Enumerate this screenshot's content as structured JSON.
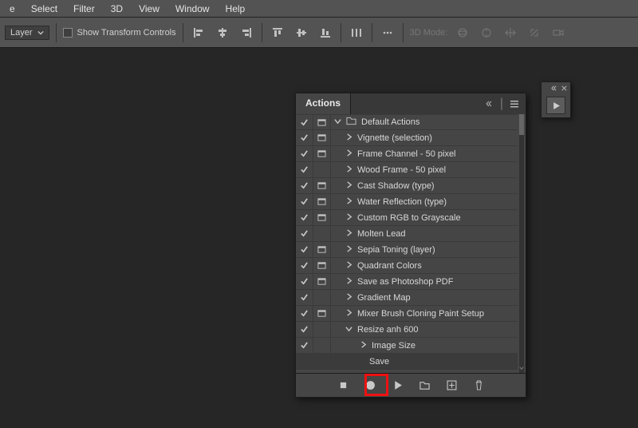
{
  "menu": {
    "items": [
      "e",
      "Select",
      "Filter",
      "3D",
      "View",
      "Window",
      "Help"
    ]
  },
  "optbar": {
    "layer_dd": "Layer",
    "show_tc": "Show Transform Controls",
    "mode_label": "3D Mode:"
  },
  "panel": {
    "tab": "Actions",
    "items": [
      {
        "chk": true,
        "dlg": "toggle",
        "indent": 0,
        "disc": "down",
        "folder": true,
        "label": "Default Actions"
      },
      {
        "chk": true,
        "dlg": "toggle",
        "indent": 1,
        "disc": "right",
        "label": "Vignette (selection)"
      },
      {
        "chk": true,
        "dlg": "toggle",
        "indent": 1,
        "disc": "right",
        "label": "Frame Channel - 50 pixel"
      },
      {
        "chk": true,
        "dlg": "empty",
        "indent": 1,
        "disc": "right",
        "label": "Wood Frame - 50 pixel"
      },
      {
        "chk": true,
        "dlg": "toggle",
        "indent": 1,
        "disc": "right",
        "label": "Cast Shadow (type)"
      },
      {
        "chk": true,
        "dlg": "toggle",
        "indent": 1,
        "disc": "right",
        "label": "Water Reflection (type)"
      },
      {
        "chk": true,
        "dlg": "toggle",
        "indent": 1,
        "disc": "right",
        "label": "Custom RGB to Grayscale"
      },
      {
        "chk": true,
        "dlg": "empty",
        "indent": 1,
        "disc": "right",
        "label": "Molten Lead"
      },
      {
        "chk": true,
        "dlg": "toggle",
        "indent": 1,
        "disc": "right",
        "label": "Sepia Toning (layer)"
      },
      {
        "chk": true,
        "dlg": "toggle",
        "indent": 1,
        "disc": "right",
        "label": "Quadrant Colors"
      },
      {
        "chk": true,
        "dlg": "toggle",
        "indent": 1,
        "disc": "right",
        "label": "Save as Photoshop PDF"
      },
      {
        "chk": true,
        "dlg": "empty",
        "indent": 1,
        "disc": "right",
        "label": "Gradient Map"
      },
      {
        "chk": true,
        "dlg": "toggle",
        "indent": 1,
        "disc": "right",
        "label": "Mixer Brush Cloning Paint Setup"
      },
      {
        "chk": true,
        "dlg": "empty",
        "indent": 1,
        "disc": "down",
        "label": "Resize anh 600"
      },
      {
        "chk": true,
        "dlg": "empty",
        "indent": 2,
        "disc": "right",
        "label": "Image Size"
      },
      {
        "chk": false,
        "dlg": "empty",
        "indent": 3,
        "disc": "",
        "label": "Save",
        "selected": true
      }
    ]
  }
}
